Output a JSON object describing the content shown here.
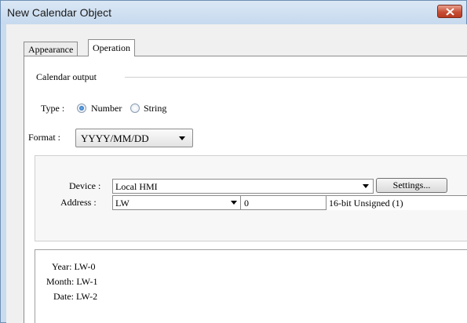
{
  "window": {
    "title": "New Calendar Object"
  },
  "tabs": [
    {
      "label": "Appearance",
      "active": false
    },
    {
      "label": "Operation",
      "active": true
    }
  ],
  "calendar_output": {
    "group_label": "Calendar output",
    "type_label": "Type :",
    "type_options": [
      {
        "label": "Number",
        "checked": true
      },
      {
        "label": "String",
        "checked": false
      }
    ],
    "format_label": "Format :",
    "format_value": "YYYY/MM/DD"
  },
  "device": {
    "device_label": "Device :",
    "device_value": "Local HMI",
    "settings_label": "Settings...",
    "address_label": "Address :",
    "address_type": "LW",
    "address_value": "0",
    "address_format": "16-bit Unsigned (1)"
  },
  "output": {
    "year": "Year: LW-0",
    "month": "Month: LW-1",
    "date": "Date: LW-2"
  },
  "colors": {
    "title_bar": "#c6d9ee",
    "close_button": "#c75037",
    "radio_checked": "#1e5ea8"
  }
}
